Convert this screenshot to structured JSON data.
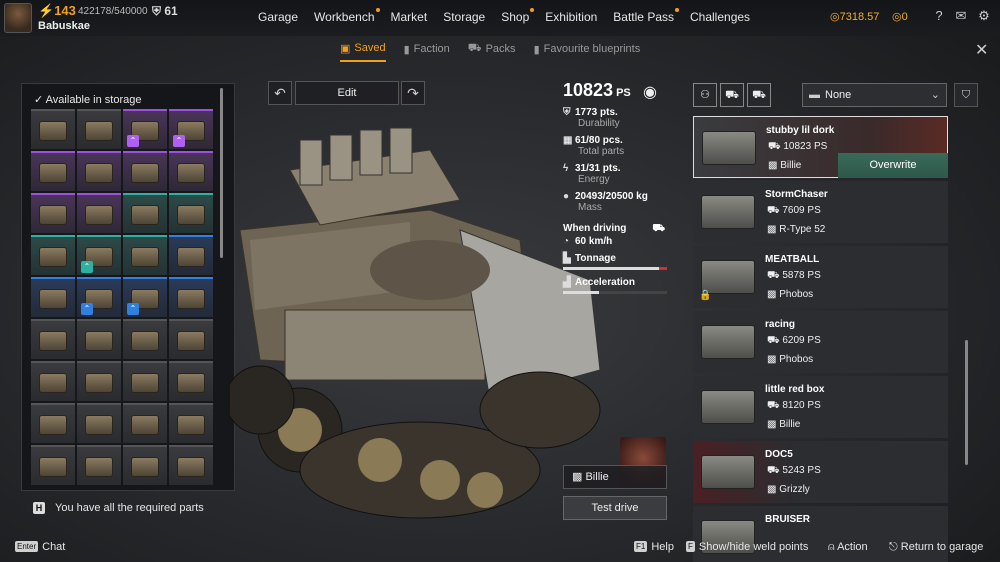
{
  "player": {
    "level": "143",
    "xp": "422178/540000",
    "badge_count": "61",
    "username": "Babuskae"
  },
  "nav": {
    "items": [
      {
        "label": "Garage",
        "dot": false
      },
      {
        "label": "Workbench",
        "dot": true
      },
      {
        "label": "Market",
        "dot": false
      },
      {
        "label": "Storage",
        "dot": false
      },
      {
        "label": "Shop",
        "dot": true
      },
      {
        "label": "Exhibition",
        "dot": false
      },
      {
        "label": "Battle Pass",
        "dot": true
      },
      {
        "label": "Challenges",
        "dot": false
      }
    ]
  },
  "currency": {
    "coins": "7318.57",
    "badges": "0"
  },
  "tabs": {
    "saved": "Saved",
    "faction": "Faction",
    "packs": "Packs",
    "favourites": "Favourite blueprints"
  },
  "storage": {
    "title": "Available in storage",
    "cells": [
      {
        "tier": "normal",
        "upgrade": ""
      },
      {
        "tier": "normal",
        "upgrade": ""
      },
      {
        "tier": "purple",
        "upgrade": "purple"
      },
      {
        "tier": "purple",
        "upgrade": "purple"
      },
      {
        "tier": "purple",
        "upgrade": ""
      },
      {
        "tier": "purple",
        "upgrade": ""
      },
      {
        "tier": "purple",
        "upgrade": ""
      },
      {
        "tier": "purple",
        "upgrade": ""
      },
      {
        "tier": "purple",
        "upgrade": ""
      },
      {
        "tier": "purple",
        "upgrade": ""
      },
      {
        "tier": "teal",
        "upgrade": ""
      },
      {
        "tier": "teal",
        "upgrade": ""
      },
      {
        "tier": "teal",
        "upgrade": ""
      },
      {
        "tier": "teal",
        "upgrade": "teal"
      },
      {
        "tier": "teal",
        "upgrade": ""
      },
      {
        "tier": "blue",
        "upgrade": ""
      },
      {
        "tier": "blue",
        "upgrade": ""
      },
      {
        "tier": "blue",
        "upgrade": "blue"
      },
      {
        "tier": "blue",
        "upgrade": "blue"
      },
      {
        "tier": "blue",
        "upgrade": ""
      },
      {
        "tier": "normal",
        "upgrade": ""
      },
      {
        "tier": "normal",
        "upgrade": ""
      },
      {
        "tier": "normal",
        "upgrade": ""
      },
      {
        "tier": "normal",
        "upgrade": ""
      },
      {
        "tier": "normal",
        "upgrade": ""
      },
      {
        "tier": "normal",
        "upgrade": ""
      },
      {
        "tier": "normal",
        "upgrade": ""
      },
      {
        "tier": "normal",
        "upgrade": ""
      },
      {
        "tier": "normal",
        "upgrade": ""
      },
      {
        "tier": "normal",
        "upgrade": ""
      },
      {
        "tier": "normal",
        "upgrade": ""
      },
      {
        "tier": "normal",
        "upgrade": ""
      },
      {
        "tier": "normal",
        "upgrade": ""
      },
      {
        "tier": "normal",
        "upgrade": ""
      },
      {
        "tier": "normal",
        "upgrade": ""
      },
      {
        "tier": "normal",
        "upgrade": ""
      }
    ],
    "required": "You have all the required parts",
    "required_key": "H"
  },
  "edit": {
    "label": "Edit"
  },
  "stats": {
    "ps": "10823",
    "ps_unit": "PS",
    "durability": "1773 pts.",
    "durability_label": "Durability",
    "parts": "61/80 pcs.",
    "parts_label": "Total parts",
    "energy": "31/31 pts.",
    "energy_label": "Energy",
    "mass": "20493/20500 kg",
    "mass_label": "Mass",
    "when_driving": "When driving",
    "speed": "60 km/h",
    "tonnage_label": "Tonnage",
    "tonnage_fill": 0.97,
    "accel_label": "Acceleration",
    "accel_fill": 0.35
  },
  "driver": {
    "name": "Billie"
  },
  "test_drive": "Test drive",
  "filter": {
    "selected": "None"
  },
  "vehicles": [
    {
      "name": "stubby lil dork",
      "ps": "10823 PS",
      "driver": "Billie",
      "selected": true,
      "locked": false,
      "red": false,
      "action": "Overwrite"
    },
    {
      "name": "StormChaser",
      "ps": "7609 PS",
      "driver": "R-Type 52",
      "selected": false,
      "locked": false,
      "red": false,
      "action": ""
    },
    {
      "name": "MEATBALL",
      "ps": "5878 PS",
      "driver": "Phobos",
      "selected": false,
      "locked": true,
      "red": false,
      "action": ""
    },
    {
      "name": "racing",
      "ps": "6209 PS",
      "driver": "Phobos",
      "selected": false,
      "locked": false,
      "red": false,
      "action": ""
    },
    {
      "name": "little red box",
      "ps": "8120 PS",
      "driver": "Billie",
      "selected": false,
      "locked": false,
      "red": false,
      "action": ""
    },
    {
      "name": "DOC5",
      "ps": "5243 PS",
      "driver": "Grizzly",
      "selected": false,
      "locked": false,
      "red": true,
      "action": ""
    },
    {
      "name": "BRUISER",
      "ps": "",
      "driver": "",
      "selected": false,
      "locked": false,
      "red": false,
      "action": ""
    }
  ],
  "footer": {
    "chat_key": "Enter",
    "chat": "Chat",
    "help_key": "F1",
    "help": "Help",
    "weld_key": "F",
    "weld": "Show/hide weld points",
    "action": "Action",
    "return": "Return to garage"
  }
}
